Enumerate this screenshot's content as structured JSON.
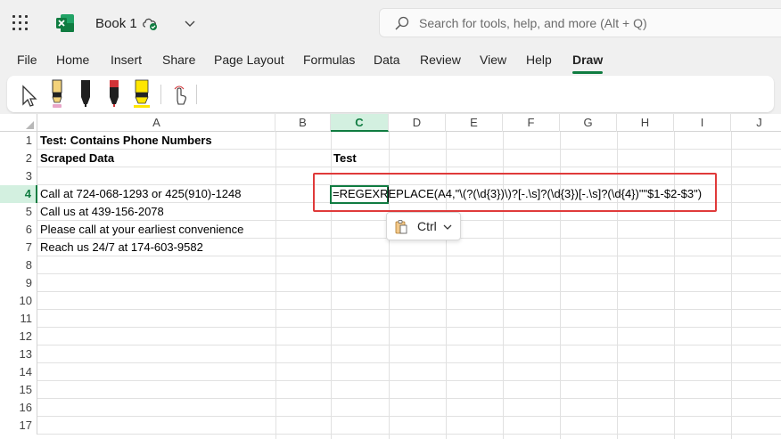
{
  "titlebar": {
    "app_icon": "excel-icon",
    "book_title": "Book 1",
    "status_icon": "cloud-saved-icon",
    "search_placeholder": "Search for tools, help, and more (Alt + Q)"
  },
  "menu": {
    "items": [
      "File",
      "Home",
      "Insert",
      "Share",
      "Page Layout",
      "Formulas",
      "Data",
      "Review",
      "View",
      "Help",
      "Draw"
    ],
    "active": "Draw"
  },
  "toolbar": {
    "tools": [
      "select-pointer-icon",
      "pencil-pink-icon",
      "pen-black-icon",
      "pen-red-icon",
      "highlighter-yellow-icon",
      "touch-draw-icon"
    ]
  },
  "colors": {
    "accent": "#107c41",
    "annotation": "#e03a3a",
    "selected_header": "#d3f0e0"
  },
  "grid": {
    "columns": [
      "A",
      "B",
      "C",
      "D",
      "E",
      "F",
      "G",
      "H",
      "I",
      "J"
    ],
    "selected_column": "C",
    "rows": [
      "1",
      "2",
      "3",
      "4",
      "5",
      "6",
      "7",
      "8",
      "9",
      "10",
      "11",
      "12",
      "13",
      "14",
      "15",
      "16",
      "17"
    ],
    "selected_row": "4",
    "cells": {
      "A1": "Test: Contains Phone Numbers",
      "A2": "Scraped Data",
      "C2": "Test",
      "A4": "Call at 724-068-1293 or 425(910)-1248",
      "A5": "Call us at 439-156-2078",
      "A6": "Please call at your earliest convenience",
      "A7": "Reach us 24/7 at 174-603-9582"
    },
    "editing_cell": "C4",
    "editing_formula": "=REGEXREPLACE(A4,\"\\(?(\\d{3})\\)?[-.\\s]?(\\d{3})[-.\\s]?(\\d{4})\"\"$1-$2-$3\")"
  },
  "paste_options": {
    "icon": "clipboard-icon",
    "label": "Ctrl"
  }
}
